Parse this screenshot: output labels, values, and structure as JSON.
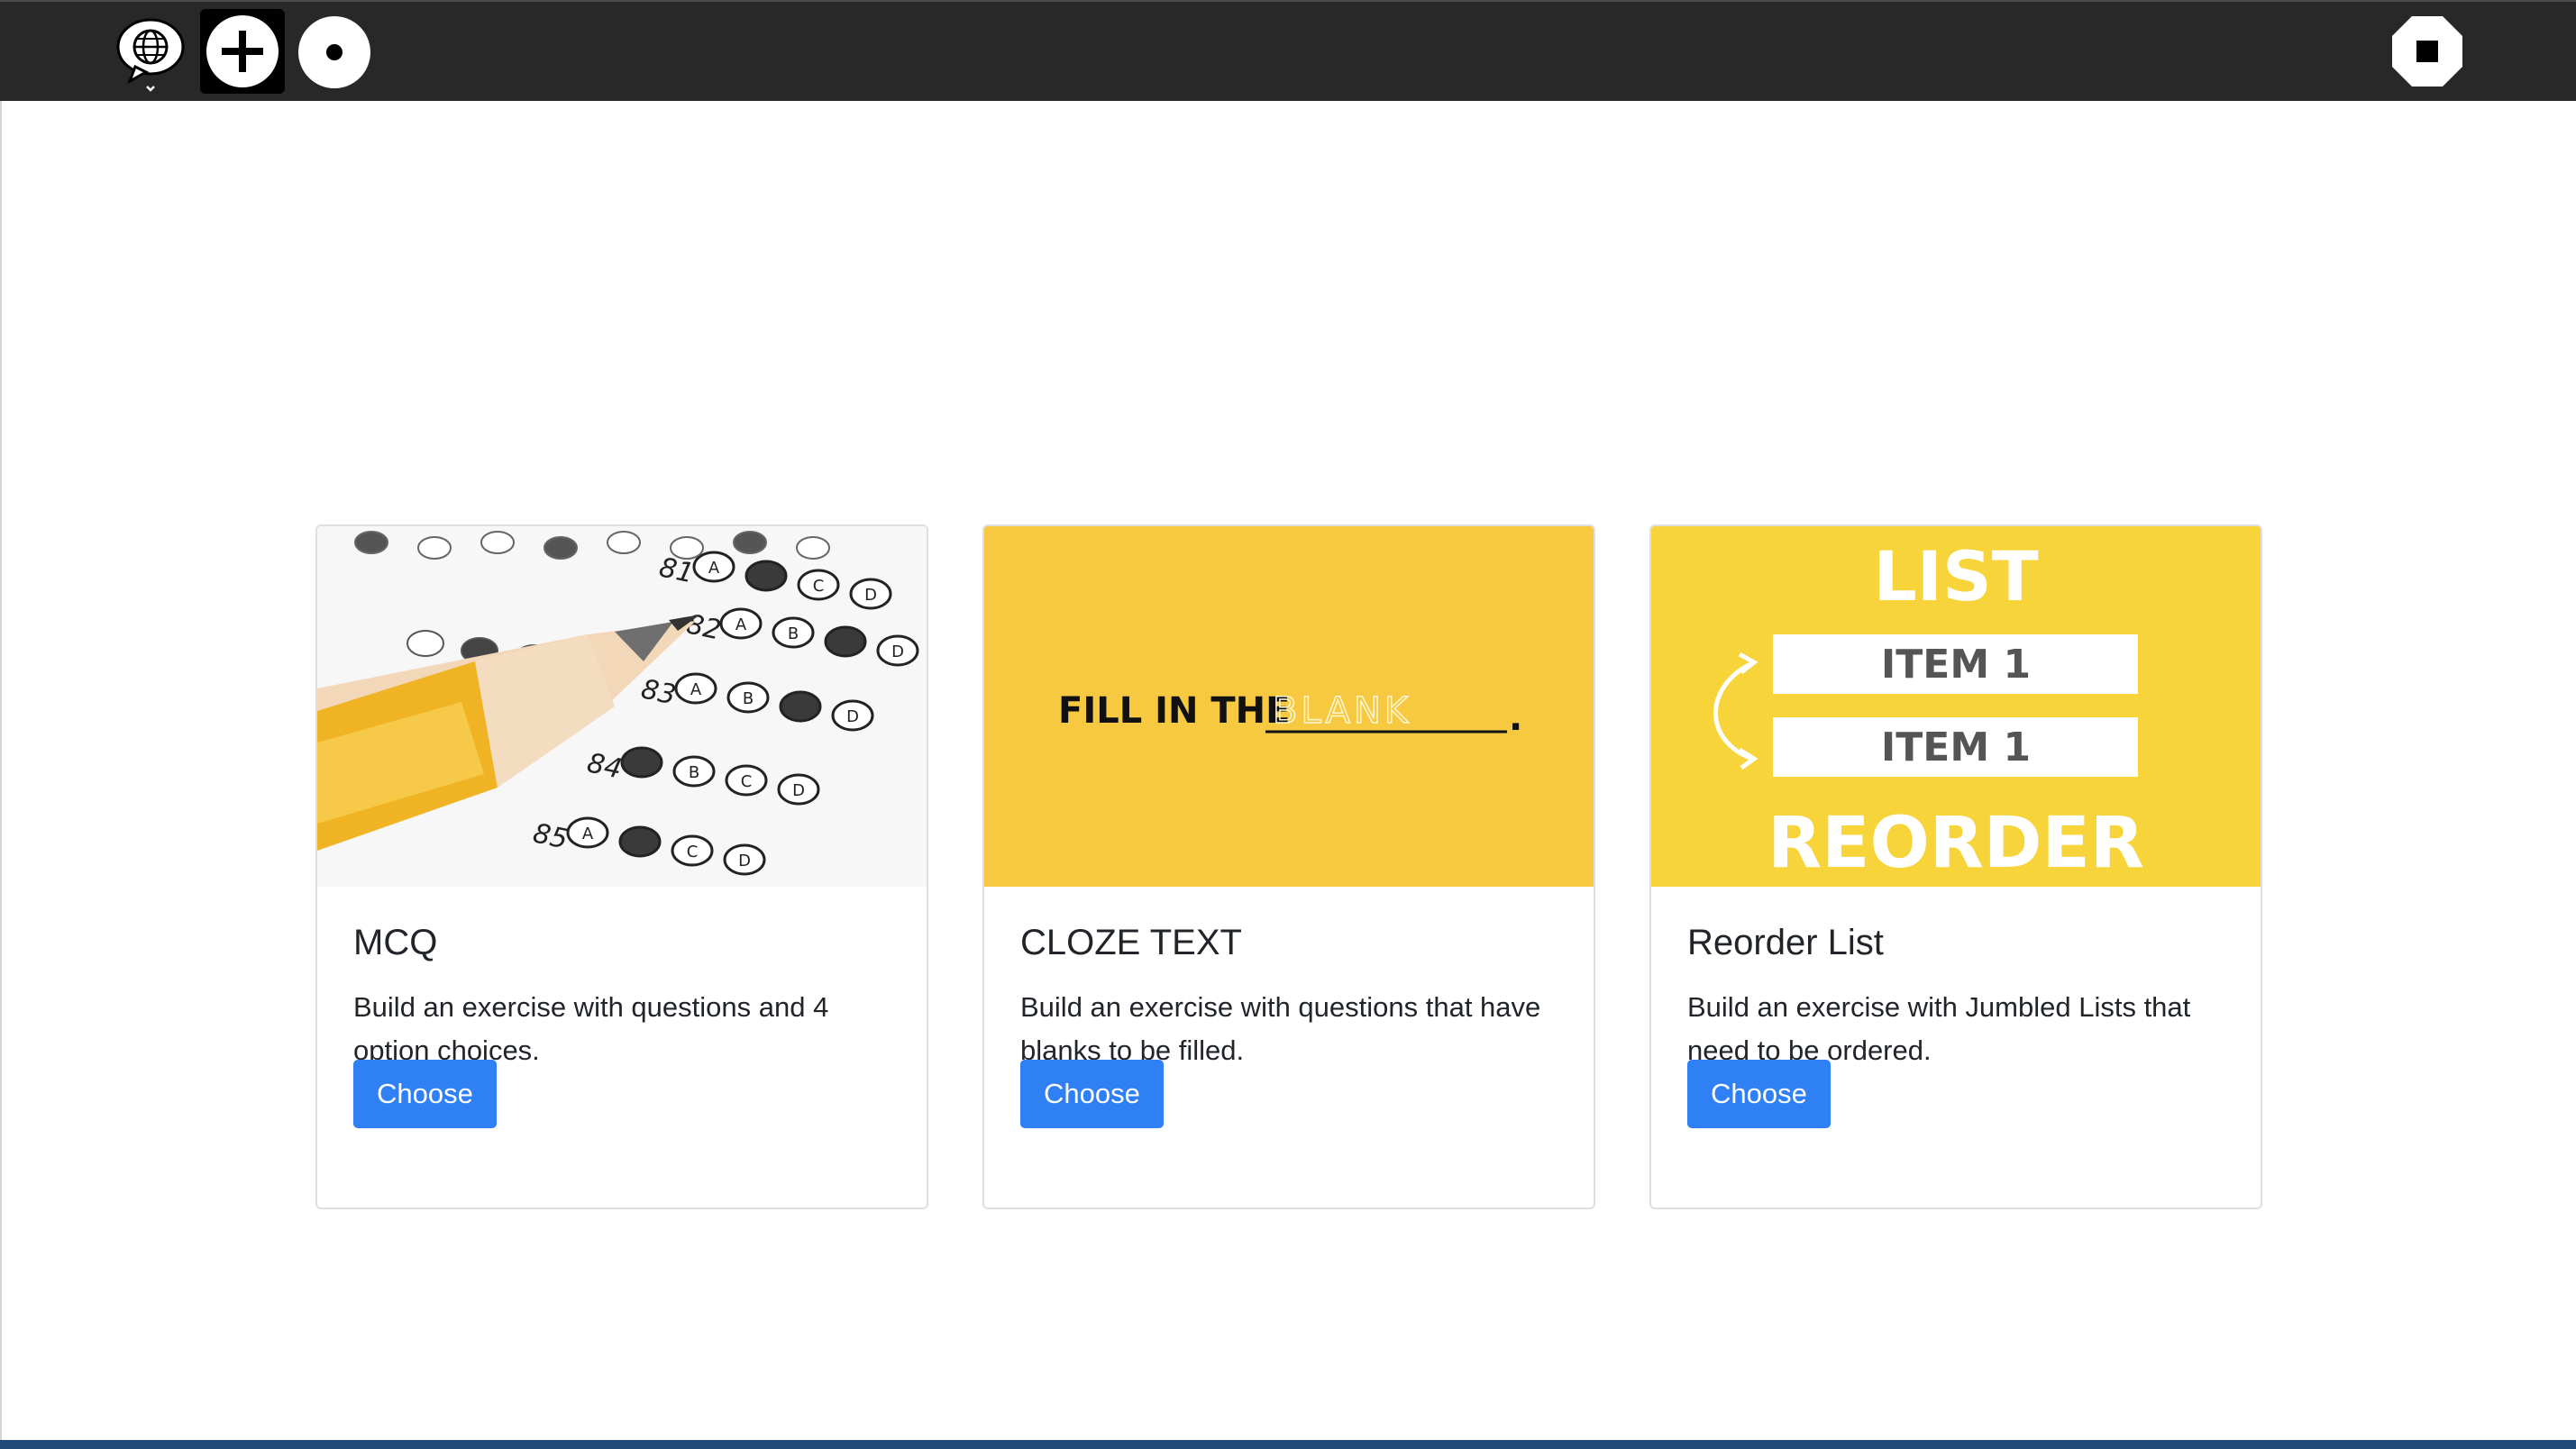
{
  "toolbar": {
    "items": [
      {
        "icon": "network-chat-icon"
      },
      {
        "icon": "add-icon"
      },
      {
        "icon": "record-icon"
      }
    ],
    "right_icon": "stop-icon",
    "background": "#282828"
  },
  "cards": [
    {
      "title": "MCQ",
      "description": "Build an exercise with questions and 4 option choices.",
      "button": "Choose",
      "image": {
        "kind": "answer-sheet-photo",
        "numbers": [
          "81",
          "82",
          "83",
          "84",
          "85"
        ],
        "bubble_letters": [
          "A",
          "B",
          "C",
          "D"
        ]
      }
    },
    {
      "title": "CLOZE TEXT",
      "description": "Build an exercise with questions that have blanks to be filled.",
      "button": "Choose",
      "image": {
        "kind": "fill-in-the-blank",
        "text": "FILL IN THE",
        "blank_word": "BLANK",
        "punct": ".",
        "background": "#f6c941"
      }
    },
    {
      "title": "Reorder List",
      "description": "Build an exercise with Jumbled Lists that need to be ordered.",
      "button": "Choose",
      "image": {
        "kind": "reorder-list",
        "heading": "LIST",
        "items": [
          "ITEM 1",
          "ITEM 1"
        ],
        "footer": "REORDER",
        "background": "#f8d43b"
      }
    }
  ],
  "colors": {
    "accent": "#2f7ff5",
    "text": "#212529",
    "card_border": "#dfdfdf",
    "page_background": "#ffffff"
  }
}
